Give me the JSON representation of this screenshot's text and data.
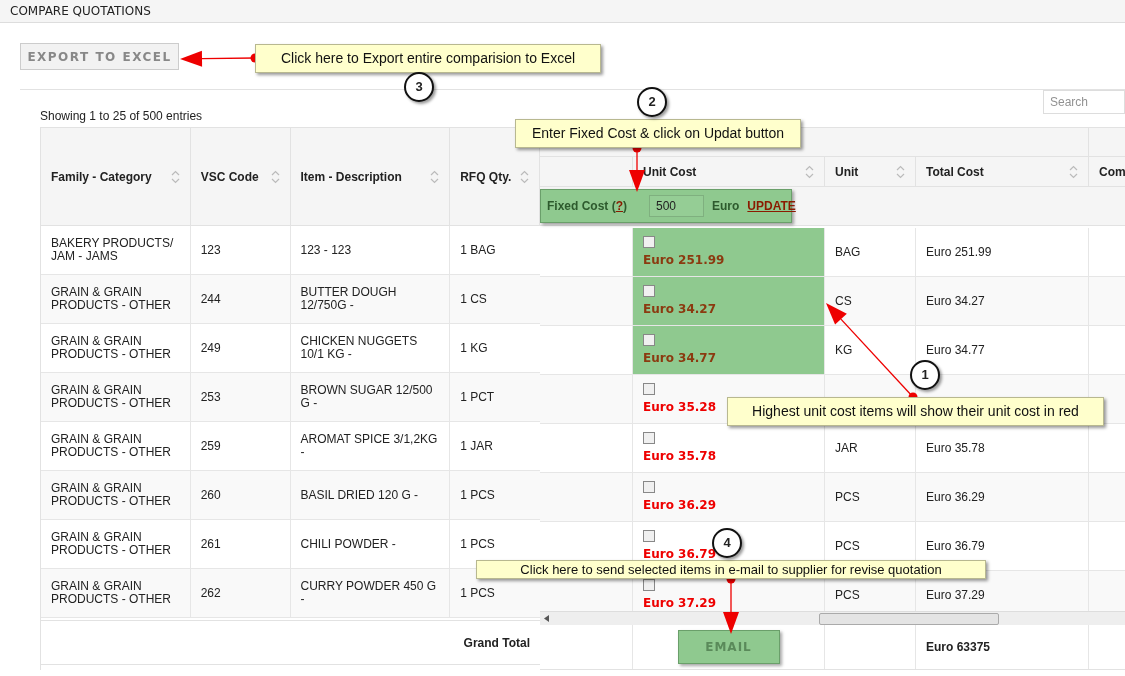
{
  "page_title": "COMPARE QUOTATIONS",
  "export_button": "EXPORT TO EXCEL",
  "entries_info": "Showing 1 to 25 of 500 entries",
  "search": {
    "placeholder": "Search"
  },
  "left_columns": [
    "Family - Category",
    "VSC Code",
    "Item - Description",
    "RFQ Qty."
  ],
  "right_columns": [
    "Unit Cost",
    "Unit",
    "Total Cost",
    "Com"
  ],
  "fixed_cost": {
    "label": "Fixed Cost (",
    "help": "?",
    "label_end": ")",
    "value": "500",
    "currency": "Euro",
    "update_link": "UPDATE",
    "highlighted": true
  },
  "rows": [
    {
      "family": "BAKERY PRODUCTS/ JAM - JAMS",
      "code": "123",
      "item": "123 - 123",
      "qty": "1 BAG",
      "unit_cost": "Euro 251.99",
      "checked": false,
      "highlighted": true,
      "unit": "BAG",
      "total": "Euro 251.99"
    },
    {
      "family": "GRAIN & GRAIN PRODUCTS - OTHER",
      "code": "244",
      "item": "BUTTER DOUGH 12/750G -",
      "qty": "1 CS",
      "unit_cost": "Euro 34.27",
      "checked": false,
      "highlighted": true,
      "unit": "CS",
      "total": "Euro 34.27"
    },
    {
      "family": "GRAIN & GRAIN PRODUCTS - OTHER",
      "code": "249",
      "item": "CHICKEN NUGGETS 10/1 KG -",
      "qty": "1 KG",
      "unit_cost": "Euro 34.77",
      "checked": false,
      "highlighted": true,
      "unit": "KG",
      "total": "Euro 34.77"
    },
    {
      "family": "GRAIN & GRAIN PRODUCTS - OTHER",
      "code": "253",
      "item": "BROWN SUGAR 12/500 G -",
      "qty": "1 PCT",
      "unit_cost": "Euro 35.28",
      "checked": false,
      "highlighted": false
    },
    {
      "family": "GRAIN & GRAIN PRODUCTS - OTHER",
      "code": "259",
      "item": "AROMAT SPICE 3/1,2KG -",
      "qty": "1 JAR",
      "unit_cost": "Euro 35.78",
      "checked": false,
      "highlighted": false,
      "unit": "JAR",
      "total": "Euro 35.78"
    },
    {
      "family": "GRAIN & GRAIN PRODUCTS - OTHER",
      "code": "260",
      "item": "BASIL DRIED 120 G -",
      "qty": "1 PCS",
      "unit_cost": "Euro 36.29",
      "checked": false,
      "highlighted": false,
      "unit": "PCS",
      "total": "Euro 36.29"
    },
    {
      "family": "GRAIN & GRAIN PRODUCTS - OTHER",
      "code": "261",
      "item": "CHILI POWDER -",
      "qty": "1 PCS",
      "unit_cost": "Euro 36.79",
      "checked": false,
      "highlighted": false,
      "unit": "PCS",
      "total": "Euro 36.79"
    },
    {
      "family": "GRAIN & GRAIN PRODUCTS - OTHER",
      "code": "262",
      "item": "CURRY POWDER 450 G -",
      "qty": "1 PCS",
      "unit_cost": "Euro 37.29",
      "checked": false,
      "highlighted": false,
      "unit": "PCS",
      "total": "Euro 37.29"
    }
  ],
  "footer": {
    "label": "Grand Total",
    "email_button": "EMAIL",
    "email_highlighted": true,
    "total": "Euro 63375"
  },
  "callouts": [
    {
      "number": "3",
      "text": "Click here to Export entire comparision to Excel"
    },
    {
      "number": "2",
      "text": "Enter Fixed Cost & click on Updat button"
    },
    {
      "number": "1",
      "text": "Highest unit cost items will show their unit cost in red"
    },
    {
      "number": "4",
      "text": "Click here to send selected items in e-mail to supplier for revise quotation"
    }
  ]
}
